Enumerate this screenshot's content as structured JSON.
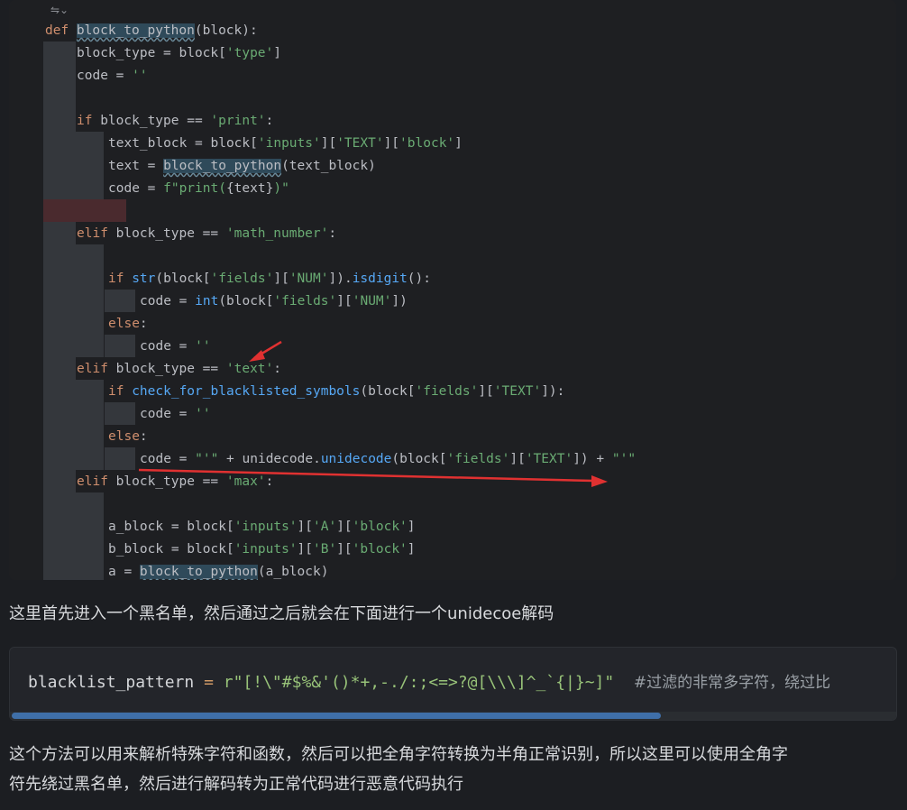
{
  "editor": {
    "toolbar_glyph": "⇋⌄",
    "lines": [
      {
        "tokens": [
          [
            "kw",
            "def "
          ],
          [
            "fnh",
            "block_to_python"
          ],
          [
            "plain",
            "(block):"
          ]
        ]
      },
      {
        "tokens": [
          [
            "plain",
            "block_type = block["
          ],
          [
            "str",
            "'type'"
          ],
          [
            "plain",
            "]"
          ]
        ]
      },
      {
        "tokens": [
          [
            "plain",
            "code = "
          ],
          [
            "str",
            "''"
          ]
        ]
      },
      {
        "tokens": []
      },
      {
        "tokens": [
          [
            "kw",
            "if "
          ],
          [
            "plain",
            "block_type == "
          ],
          [
            "str",
            "'print'"
          ],
          [
            "plain",
            ":"
          ]
        ]
      },
      {
        "tokens": [
          [
            "plain",
            "text_block = block["
          ],
          [
            "str",
            "'inputs'"
          ],
          [
            "plain",
            "]["
          ],
          [
            "str",
            "'TEXT'"
          ],
          [
            "plain",
            "]["
          ],
          [
            "str",
            "'block'"
          ],
          [
            "plain",
            "]"
          ]
        ]
      },
      {
        "tokens": [
          [
            "plain",
            "text = "
          ],
          [
            "fnh",
            "block_to_python"
          ],
          [
            "plain",
            "(text_block)"
          ]
        ]
      },
      {
        "tokens": [
          [
            "plain",
            "code = "
          ],
          [
            "str",
            "f\"print("
          ],
          [
            "plain",
            "{text}"
          ],
          [
            "str",
            ")\""
          ]
        ]
      },
      {
        "tokens": []
      },
      {
        "tokens": [
          [
            "kw",
            "elif "
          ],
          [
            "plain",
            "block_type == "
          ],
          [
            "str",
            "'math_number'"
          ],
          [
            "plain",
            ":"
          ]
        ]
      },
      {
        "tokens": []
      },
      {
        "tokens": [
          [
            "kw",
            "if "
          ],
          [
            "fn",
            "str"
          ],
          [
            "plain",
            "(block["
          ],
          [
            "str",
            "'fields'"
          ],
          [
            "plain",
            "]["
          ],
          [
            "str",
            "'NUM'"
          ],
          [
            "plain",
            "])."
          ],
          [
            "fn",
            "isdigit"
          ],
          [
            "plain",
            "():"
          ]
        ]
      },
      {
        "tokens": [
          [
            "plain",
            "code = "
          ],
          [
            "fn",
            "int"
          ],
          [
            "plain",
            "(block["
          ],
          [
            "str",
            "'fields'"
          ],
          [
            "plain",
            "]["
          ],
          [
            "str",
            "'NUM'"
          ],
          [
            "plain",
            "])"
          ]
        ]
      },
      {
        "tokens": [
          [
            "kw",
            "else"
          ],
          [
            "plain",
            ":"
          ]
        ]
      },
      {
        "tokens": [
          [
            "plain",
            "code = "
          ],
          [
            "str",
            "''"
          ]
        ]
      },
      {
        "tokens": [
          [
            "kw",
            "elif "
          ],
          [
            "plain",
            "block_type == "
          ],
          [
            "str",
            "'text'"
          ],
          [
            "plain",
            ":"
          ]
        ]
      },
      {
        "tokens": [
          [
            "kw",
            "if "
          ],
          [
            "fn",
            "check_for_blacklisted_symbols"
          ],
          [
            "plain",
            "(block["
          ],
          [
            "str",
            "'fields'"
          ],
          [
            "plain",
            "]["
          ],
          [
            "str",
            "'TEXT'"
          ],
          [
            "plain",
            "]):"
          ]
        ]
      },
      {
        "tokens": [
          [
            "plain",
            "code = "
          ],
          [
            "str",
            "''"
          ]
        ]
      },
      {
        "tokens": [
          [
            "kw",
            "else"
          ],
          [
            "plain",
            ":"
          ]
        ]
      },
      {
        "tokens": [
          [
            "plain",
            "code = "
          ],
          [
            "str",
            "\"'\""
          ],
          [
            "plain",
            " + unidecode."
          ],
          [
            "fn",
            "unidecode"
          ],
          [
            "plain",
            "(block["
          ],
          [
            "str",
            "'fields'"
          ],
          [
            "plain",
            "]["
          ],
          [
            "str",
            "'TEXT'"
          ],
          [
            "plain",
            "]) + "
          ],
          [
            "str",
            "\"'\""
          ]
        ]
      },
      {
        "tokens": [
          [
            "kw",
            "elif "
          ],
          [
            "plain",
            "block_type == "
          ],
          [
            "str",
            "'max'"
          ],
          [
            "plain",
            ":"
          ]
        ]
      },
      {
        "tokens": []
      },
      {
        "tokens": [
          [
            "plain",
            "a_block = block["
          ],
          [
            "str",
            "'inputs'"
          ],
          [
            "plain",
            "]["
          ],
          [
            "str",
            "'A'"
          ],
          [
            "plain",
            "]["
          ],
          [
            "str",
            "'block'"
          ],
          [
            "plain",
            "]"
          ]
        ]
      },
      {
        "tokens": [
          [
            "plain",
            "b_block = block["
          ],
          [
            "str",
            "'inputs'"
          ],
          [
            "plain",
            "]["
          ],
          [
            "str",
            "'B'"
          ],
          [
            "plain",
            "]["
          ],
          [
            "str",
            "'block'"
          ],
          [
            "plain",
            "]"
          ]
        ]
      },
      {
        "tokens": [
          [
            "plain",
            "a = "
          ],
          [
            "fnh",
            "block_to_python"
          ],
          [
            "plain",
            "(a_block)"
          ]
        ]
      }
    ]
  },
  "paragraph1": "这里首先进入一个黑名单，然后通过之后就会在下面进行一个unidecoe解码",
  "snippet": {
    "var": "blacklist_pattern",
    "op": " = ",
    "value": "r\"[!\\\"#$%&'()*+,-./:;<=>?@[\\\\\\]^_`{|}~]\"",
    "comment": "    #过滤的非常多字符，绕过比"
  },
  "paragraph2_line1": "这个方法可以用来解析特殊字符和函数，然后可以把全角字符转换为半角正常识别，所以这里可以使用全角字",
  "paragraph2_line2": "符先绕过黑名单，然后进行解码转为正常代码进行恶意代码执行",
  "colors": {
    "keyword": "#cf8e6d",
    "string": "#6aab73",
    "function": "#56a8f5",
    "arrow": "#e03131",
    "scroll_thumb": "#3f6fa8"
  }
}
